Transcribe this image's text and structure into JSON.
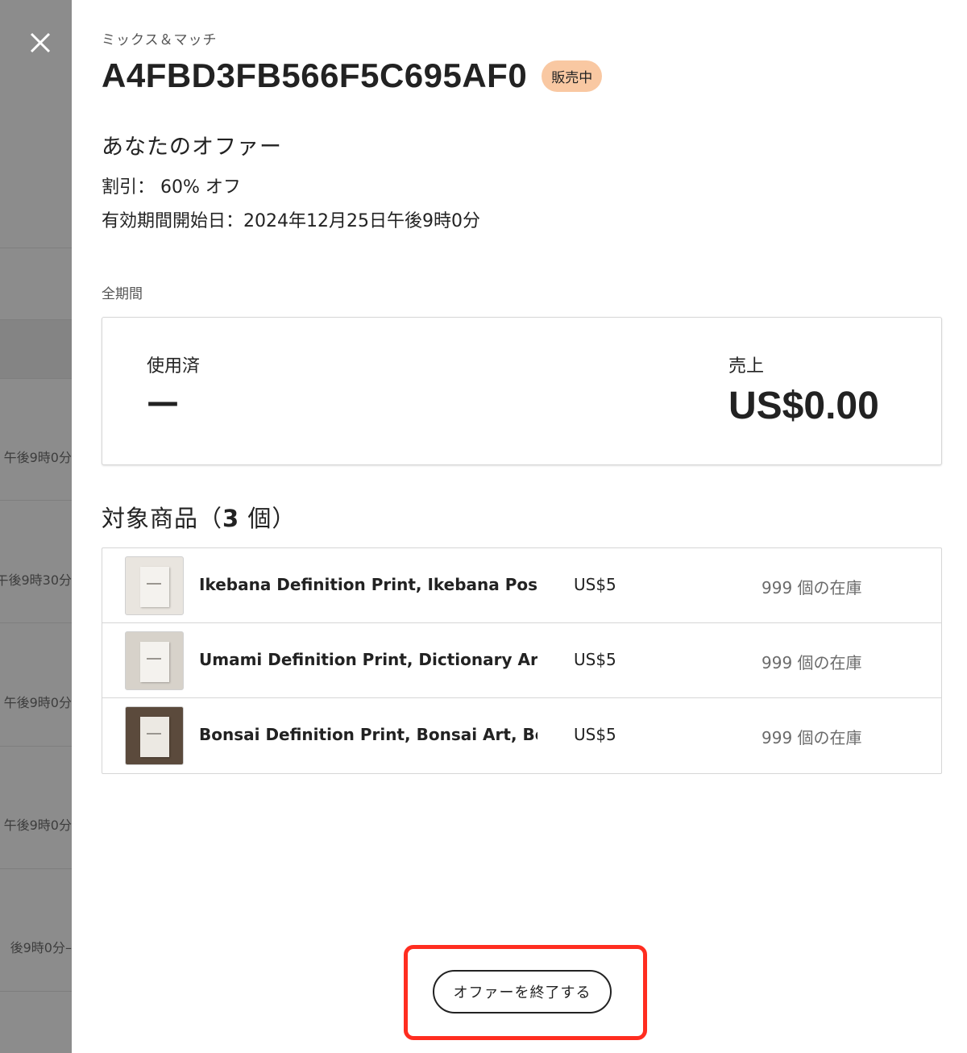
{
  "background": {
    "partial_texts": [
      "午後9時0分",
      "午後9時30分",
      "午後9時0分",
      "午後9時0分",
      "後9時0分–"
    ]
  },
  "header": {
    "offer_type": "ミックス＆マッチ",
    "code": "A4FBD3FB566F5C695AF0",
    "status": "販売中"
  },
  "offer": {
    "heading": "あなたのオファー",
    "discount": "割引： 60% オフ",
    "start_date": "有効期間開始日：2024年12月25日午後9時0分"
  },
  "stats": {
    "period": "全期間",
    "used_label": "使用済",
    "used_value": "—",
    "sales_label": "売上",
    "sales_value": "US$0.00"
  },
  "products": {
    "heading_prefix": "対象商品（",
    "heading_count": "3",
    "heading_suffix": " 個）",
    "items": [
      {
        "name": "Ikebana Definition Print, Ikebana Post...",
        "price": "US$5",
        "stock": "999 個の在庫"
      },
      {
        "name": "Umami Definition Print, Dictionary Art ...",
        "price": "US$5",
        "stock": "999 個の在庫"
      },
      {
        "name": "Bonsai Definition Print, Bonsai Art, Bo...",
        "price": "US$5",
        "stock": "999 個の在庫"
      }
    ]
  },
  "actions": {
    "end_offer": "オファーを終了する"
  },
  "colors": {
    "badge": "#f9c8a2",
    "highlight": "#ff2d20",
    "backdrop": "#8c8c8c"
  },
  "icons": {
    "close": "close-icon"
  }
}
